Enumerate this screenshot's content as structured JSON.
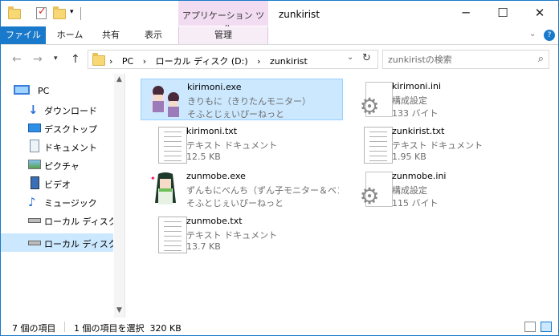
{
  "window": {
    "title": "zunkirist",
    "context_tab_group": "アプリケーション ツール",
    "minimize": "─",
    "maximize": "☐",
    "close": "✕"
  },
  "ribbon": {
    "tabs": [
      "ファイル",
      "ホーム",
      "共有",
      "表示",
      "管理"
    ],
    "expand_icon": "⌄",
    "help_icon": "?"
  },
  "address": {
    "crumbs": [
      "PC",
      "ローカル ディスク (D:)",
      "zunkirist"
    ],
    "separator": "›",
    "search_placeholder": "zunkiristの検索"
  },
  "nav_pane": {
    "items": [
      {
        "label": "PC",
        "icon": "pc-icon"
      },
      {
        "label": "ダウンロード",
        "icon": "download-icon"
      },
      {
        "label": "デスクトップ",
        "icon": "desktop-icon"
      },
      {
        "label": "ドキュメント",
        "icon": "documents-icon"
      },
      {
        "label": "ピクチャ",
        "icon": "pictures-icon"
      },
      {
        "label": "ビデオ",
        "icon": "videos-icon"
      },
      {
        "label": "ミュージック",
        "icon": "music-icon"
      },
      {
        "label": "ローカル ディスク (C:)",
        "icon": "drive-icon"
      },
      {
        "label": "ローカル ディスク (D:)",
        "icon": "drive-icon",
        "selected": true
      }
    ]
  },
  "files": [
    {
      "name": "kirimoni.exe",
      "l2": "きりもに（きりたんモニター）",
      "l3": "そふとじぇいぴーねっと",
      "icon": "app-kiritan-icon",
      "selected": true
    },
    {
      "name": "kirimoni.ini",
      "l2": "構成設定",
      "l3": "133 バイト",
      "icon": "ini-file-icon"
    },
    {
      "name": "kirimoni.txt",
      "l2": "テキスト ドキュメント",
      "l3": "12.5 KB",
      "icon": "text-file-icon"
    },
    {
      "name": "zunkirist.txt",
      "l2": "テキスト ドキュメント",
      "l3": "1.95 KB",
      "icon": "text-file-icon"
    },
    {
      "name": "zunmobe.exe",
      "l2": "ずんもにべんち（ずん子モニター＆ベン…",
      "l3": "そふとじぇいぴーねっと",
      "icon": "app-zunko-icon"
    },
    {
      "name": "zunmobe.ini",
      "l2": "構成設定",
      "l3": "115 バイト",
      "icon": "ini-file-icon"
    },
    {
      "name": "zunmobe.txt",
      "l2": "テキスト ドキュメント",
      "l3": "13.7 KB",
      "icon": "text-file-icon"
    }
  ],
  "status": {
    "item_count": "7 個の項目",
    "selection": "1 個の項目を選択  320 KB"
  }
}
